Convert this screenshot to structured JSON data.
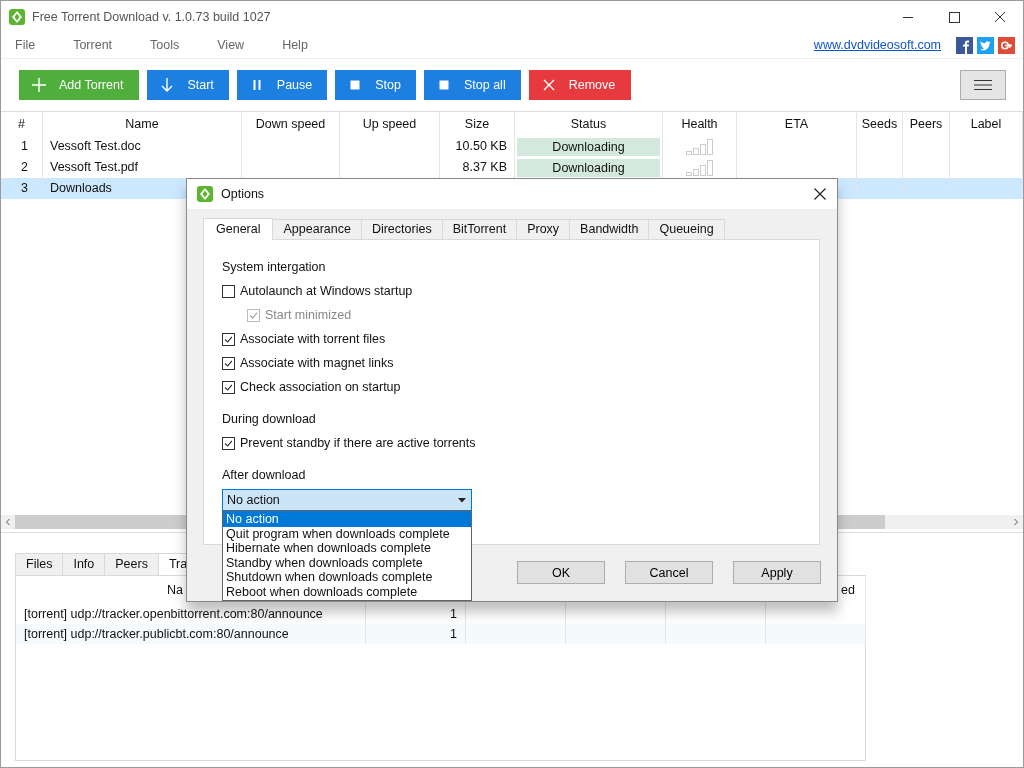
{
  "window": {
    "title": "Free Torrent Download v. 1.0.73 build 1027"
  },
  "menu": [
    "File",
    "Torrent",
    "Tools",
    "View",
    "Help"
  ],
  "website_link": "www.dvdvideosoft.com",
  "toolbar": [
    {
      "label": "Add Torrent",
      "kind": "add"
    },
    {
      "label": "Start",
      "kind": "start"
    },
    {
      "label": "Pause",
      "kind": "pause"
    },
    {
      "label": "Stop",
      "kind": "stop"
    },
    {
      "label": "Stop all",
      "kind": "stop"
    },
    {
      "label": "Remove",
      "kind": "remove"
    }
  ],
  "torrents": {
    "columns": [
      "#",
      "Name",
      "Down speed",
      "Up speed",
      "Size",
      "Status",
      "Health",
      "ETA",
      "Seeds",
      "Peers",
      "Label"
    ],
    "rows": [
      {
        "index": "1",
        "name": "Vessoft Test.doc",
        "size": "10.50 KB",
        "status": "Downloading",
        "selected": false
      },
      {
        "index": "2",
        "name": "Vessoft Test.pdf",
        "size": "8.37 KB",
        "status": "Downloading",
        "selected": false
      },
      {
        "index": "3",
        "name": "Downloads",
        "selected": true
      }
    ]
  },
  "bottom_panel": {
    "tabs": [
      {
        "label": "Files",
        "selected": false
      },
      {
        "label": "Info",
        "selected": false
      },
      {
        "label": "Peers",
        "selected": false
      },
      {
        "label": "Tra",
        "selected": true
      }
    ],
    "first_header": "Na",
    "last_header": "ed",
    "rows": [
      {
        "tracker": "[torrent] udp://tracker.openbittorrent.com:80/announce",
        "count": "1"
      },
      {
        "tracker": "[torrent] udp://tracker.publicbt.com:80/announce",
        "count": "1"
      }
    ]
  },
  "dialog": {
    "title": "Options",
    "tabs": [
      {
        "label": "General",
        "selected": true
      },
      {
        "label": "Appearance",
        "selected": false
      },
      {
        "label": "Directories",
        "selected": false
      },
      {
        "label": "BitTorrent",
        "selected": false
      },
      {
        "label": "Proxy",
        "selected": false
      },
      {
        "label": "Bandwidth",
        "selected": false
      },
      {
        "label": "Queueing",
        "selected": false
      }
    ],
    "sections": [
      {
        "heading": "System intergation",
        "options": [
          {
            "label": "Autolaunch at Windows startup",
            "checked": false,
            "disabled": false,
            "children": [
              {
                "label": "Start minimized",
                "checked": true,
                "disabled": true
              }
            ]
          },
          {
            "label": "Associate with torrent files",
            "checked": true,
            "disabled": false
          },
          {
            "label": "Associate with magnet links",
            "checked": true,
            "disabled": false
          },
          {
            "label": "Check association on startup",
            "checked": true,
            "disabled": false
          }
        ]
      },
      {
        "heading": "During download",
        "options": [
          {
            "label": "Prevent standby if there are active torrents",
            "checked": true,
            "disabled": false
          }
        ]
      }
    ],
    "after_download": {
      "heading": "After download",
      "value": "No action",
      "expanded": true,
      "options": [
        {
          "label": "No action",
          "selected": true
        },
        {
          "label": "Quit program when downloads complete",
          "selected": false
        },
        {
          "label": "Hibernate when downloads complete",
          "selected": false
        },
        {
          "label": "Standby when downloads complete",
          "selected": false
        },
        {
          "label": "Shutdown when downloads complete",
          "selected": false
        },
        {
          "label": "Reboot when downloads complete",
          "selected": false
        }
      ]
    },
    "buttons": [
      "OK",
      "Cancel",
      "Apply"
    ]
  }
}
